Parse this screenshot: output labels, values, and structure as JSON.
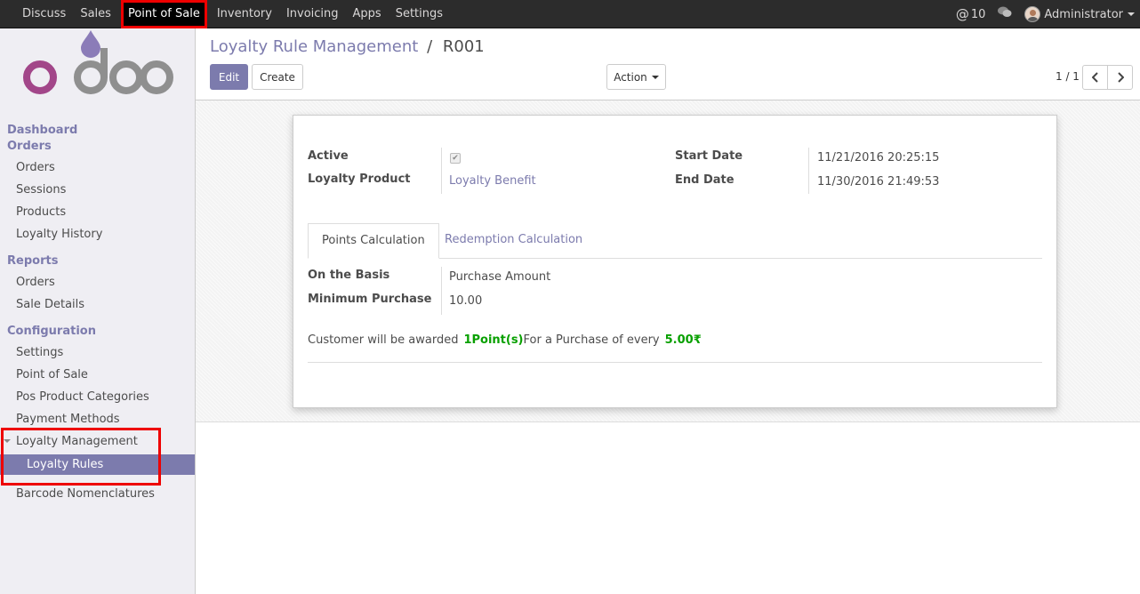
{
  "topbar": {
    "menu": [
      "Discuss",
      "Sales",
      "Point of Sale",
      "Inventory",
      "Invoicing",
      "Apps",
      "Settings"
    ],
    "active_menu": "Point of Sale",
    "mentions_count": "10",
    "user_name": "Administrator"
  },
  "sidebar": {
    "dashboard": "Dashboard",
    "orders_header": "Orders",
    "orders_items": [
      "Orders",
      "Sessions",
      "Products",
      "Loyalty History"
    ],
    "reports_header": "Reports",
    "reports_items": [
      "Orders",
      "Sale Details"
    ],
    "config_header": "Configuration",
    "config_items": [
      "Settings",
      "Point of Sale",
      "Pos Product Categories",
      "Payment Methods"
    ],
    "loyalty_management": "Loyalty Management",
    "loyalty_rules": "Loyalty Rules",
    "barcode": "Barcode Nomenclatures"
  },
  "header": {
    "breadcrumb_parent": "Loyalty Rule Management",
    "breadcrumb_sep": "/",
    "breadcrumb_current": "R001",
    "edit_label": "Edit",
    "create_label": "Create",
    "action_label": "Action",
    "pager": "1 / 1"
  },
  "form": {
    "active_label": "Active",
    "active_value": true,
    "product_label": "Loyalty Product",
    "product_value": "Loyalty Benefit",
    "start_label": "Start Date",
    "start_value": "11/21/2016 20:25:15",
    "end_label": "End Date",
    "end_value": "11/30/2016 21:49:53",
    "tabs": [
      "Points Calculation",
      "Redemption Calculation"
    ],
    "basis_label": "On the Basis",
    "basis_value": "Purchase Amount",
    "min_label": "Minimum Purchase",
    "min_value": "10.00",
    "award_prefix": "Customer will be awarded",
    "award_points": "1Point(s)",
    "award_middle": "For a Purchase of every",
    "award_amount": "5.00₹"
  },
  "colors": {
    "brand": "#7c7bad",
    "topbar": "#2c2c2c",
    "highlight": "#e00000",
    "green": "#08a000"
  }
}
